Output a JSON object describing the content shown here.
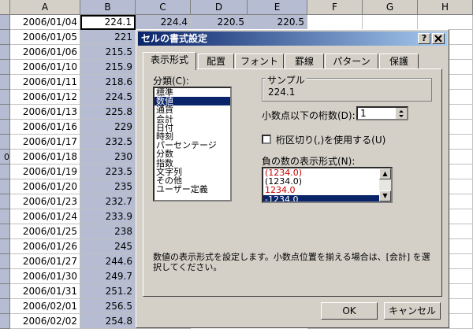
{
  "sheet": {
    "columns": [
      "A",
      "B",
      "C",
      "D",
      "E",
      "F",
      "G",
      "H"
    ],
    "row_numbers": [
      "",
      "",
      "",
      "",
      "",
      "",
      "",
      "",
      "",
      "0",
      "",
      "",
      "",
      "",
      "",
      "",
      "",
      "",
      "",
      "",
      ""
    ],
    "top_row": {
      "date": "2006/01/04",
      "b": "224.1",
      "c": "224.4",
      "d": "220.5",
      "e": "220.5"
    },
    "rows": [
      {
        "date": "2006/01/05",
        "value": "221"
      },
      {
        "date": "2006/01/06",
        "value": "215.5"
      },
      {
        "date": "2006/01/10",
        "value": "215.9"
      },
      {
        "date": "2006/01/11",
        "value": "218.6"
      },
      {
        "date": "2006/01/12",
        "value": "224.5"
      },
      {
        "date": "2006/01/13",
        "value": "225.8"
      },
      {
        "date": "2006/01/16",
        "value": "229"
      },
      {
        "date": "2006/01/17",
        "value": "232.5"
      },
      {
        "date": "2006/01/18",
        "value": "230"
      },
      {
        "date": "2006/01/19",
        "value": "223.5"
      },
      {
        "date": "2006/01/20",
        "value": "235"
      },
      {
        "date": "2006/01/23",
        "value": "232.7"
      },
      {
        "date": "2006/01/24",
        "value": "233.9"
      },
      {
        "date": "2006/01/25",
        "value": "238"
      },
      {
        "date": "2006/01/26",
        "value": "245"
      },
      {
        "date": "2006/01/27",
        "value": "244.6"
      },
      {
        "date": "2006/01/30",
        "value": "249.7"
      },
      {
        "date": "2006/01/31",
        "value": "251.2"
      },
      {
        "date": "2006/02/01",
        "value": "256.5"
      },
      {
        "date": "2006/02/02",
        "value": "254.8"
      }
    ]
  },
  "dialog": {
    "title": "セルの書式設定",
    "help_button": "?",
    "close_button": "X",
    "tabs": [
      "表示形式",
      "配置",
      "フォント",
      "罫線",
      "パターン",
      "保護"
    ],
    "category_label": "分類(C):",
    "categories": [
      "標準",
      "数値",
      "通貨",
      "会計",
      "日付",
      "時刻",
      "パーセンテージ",
      "分数",
      "指数",
      "文字列",
      "その他",
      "ユーザー定義"
    ],
    "selected_category_index": 1,
    "sample_label": "サンプル",
    "sample_value": "224.1",
    "decimal_label": "小数点以下の桁数(D):",
    "decimal_value": "1",
    "separator_label": "桁区切り(,)を使用する(U)",
    "separator_checked": false,
    "negative_label": "負の数の表示形式(N):",
    "negative_formats": [
      "(1234.0)",
      "(1234.0)",
      "1234.0",
      "-1234.0"
    ],
    "negative_red": [
      true,
      false,
      true,
      false
    ],
    "negative_selected": 3,
    "description": "数値の表示形式を設定します。小数点位置を揃える場合は、[会計] を選択してください。",
    "ok_label": "OK",
    "cancel_label": "キャンセル"
  },
  "colors": {
    "selection": "#b6bdd2",
    "title_start": "#0a246a",
    "face": "#d4d0c8",
    "negative_red": "#cc0000"
  }
}
